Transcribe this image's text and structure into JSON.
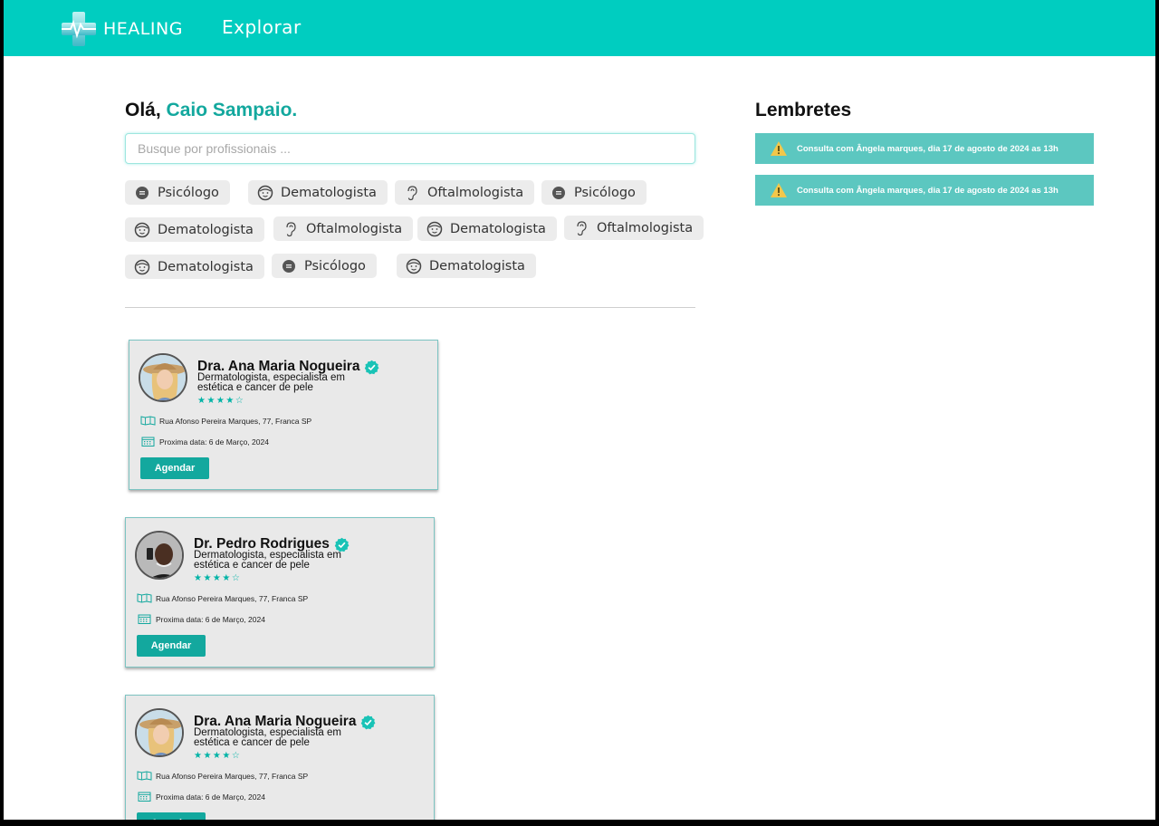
{
  "header": {
    "brand": "HEALING",
    "nav_explorar": "Explorar",
    "colors": {
      "bar": "#00cdc0",
      "accent": "#13a89e"
    }
  },
  "greeting": {
    "prefix": "Olá, ",
    "user": "Caio Sampaio."
  },
  "search": {
    "placeholder": "Busque por profissionais ..."
  },
  "chips": [
    {
      "label": "Psicólogo",
      "icon": "chat-bubble-icon"
    },
    {
      "label": "Dematologista",
      "icon": "face-icon"
    },
    {
      "label": "Oftalmologista",
      "icon": "ear-icon"
    },
    {
      "label": "Psicólogo",
      "icon": "chat-bubble-icon"
    },
    {
      "label": "Dematologista",
      "icon": "face-icon"
    },
    {
      "label": "Oftalmologista",
      "icon": "ear-icon"
    },
    {
      "label": "Dematologista",
      "icon": "face-icon"
    },
    {
      "label": "Oftalmologista",
      "icon": "ear-icon"
    },
    {
      "label": "Dematologista",
      "icon": "face-icon"
    },
    {
      "label": "Psicólogo",
      "icon": "chat-bubble-icon"
    },
    {
      "label": "Dematologista",
      "icon": "face-icon"
    }
  ],
  "doctors": [
    {
      "name": "Dra. Ana Maria Nogueira",
      "specialty": "Dermatologista, especialista em estética e cancer de pele",
      "rating": 4,
      "stars": "★★★★☆",
      "address": "Rua Afonso Pereira Marques, 77, Franca SP",
      "next_date": "Proxima data: 6 de Março, 2024",
      "button": "Agendar"
    },
    {
      "name": "Dr. Pedro Rodrigues",
      "specialty": "Dermatologista, especialista em estética e cancer de pele",
      "rating": 4,
      "stars": "★★★★☆",
      "address": "Rua Afonso Pereira Marques, 77, Franca SP",
      "next_date": "Proxima data: 6 de Março, 2024",
      "button": "Agendar"
    },
    {
      "name": "Dra. Ana Maria Nogueira",
      "specialty": "Dermatologista, especialista em estética e cancer de pele",
      "rating": 4,
      "stars": "★★★★☆",
      "address": "Rua Afonso Pereira Marques, 77, Franca SP",
      "next_date": "Proxima data: 6 de Março, 2024",
      "button": "Agendar"
    }
  ],
  "lembretes": {
    "title": "Lembretes",
    "items": [
      "Consulta com Ângela marques, dia 17 de agosto de 2024 as 13h",
      "Consulta com Ângela marques, dia 17 de agosto de 2024 as 13h"
    ]
  }
}
